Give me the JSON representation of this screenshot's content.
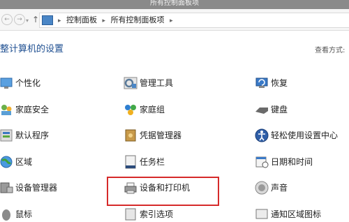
{
  "window": {
    "title": "所有控制面板项"
  },
  "address_bar": {
    "crumbs": [
      "控制面板",
      "所有控制面板项"
    ]
  },
  "header": {
    "heading": "整计算机的设置",
    "view_by": "查看方式:"
  },
  "items": {
    "col1": [
      "个性化",
      "家庭安全",
      "默认程序",
      "区域",
      "设备管理器",
      "鼠标"
    ],
    "col2": [
      "管理工具",
      "家庭组",
      "凭据管理器",
      "任务栏",
      "设备和打印机",
      "索引选项"
    ],
    "col3": [
      "恢复",
      "键盘",
      "轻松使用设置中心",
      "日期和时间",
      "声音",
      "通知区域图标"
    ]
  },
  "icons": {
    "col1": [
      "personalize-icon",
      "family-safety-icon",
      "default-programs-icon",
      "region-icon",
      "device-manager-icon",
      "mouse-icon"
    ],
    "col2": [
      "admin-tools-icon",
      "homegroup-icon",
      "credential-manager-icon",
      "taskbar-icon",
      "devices-printers-icon",
      "indexing-icon"
    ],
    "col3": [
      "recovery-icon",
      "keyboard-icon",
      "ease-of-access-icon",
      "date-time-icon",
      "sound-icon",
      "notification-icons-icon"
    ]
  },
  "highlight_color": "#d62a2a"
}
